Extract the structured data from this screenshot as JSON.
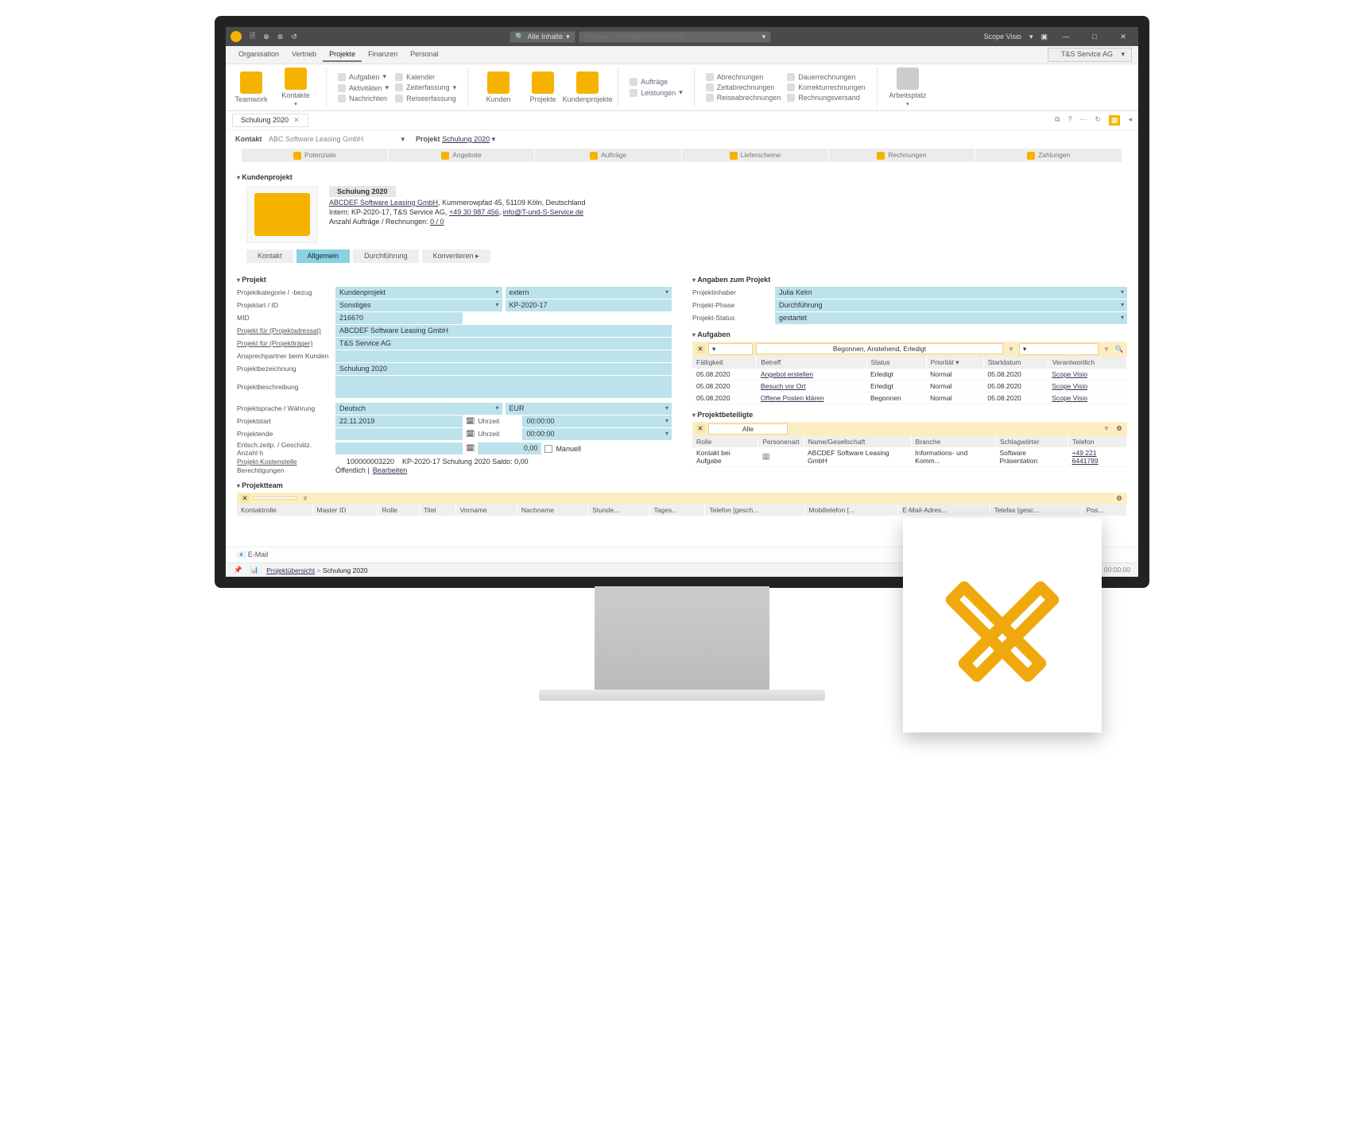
{
  "titlebar": {
    "search_chip": "Alle Inhalte",
    "search_placeholder": "Scopen – Intelligentes Suchfeld",
    "app": "Scope Visio",
    "win": {
      "min": "—",
      "max": "□",
      "close": "✕"
    }
  },
  "menubar": {
    "items": [
      "Organisation",
      "Vertrieb",
      "Projekte",
      "Finanzen",
      "Personal"
    ],
    "active": "Projekte",
    "org": "T&S Service AG"
  },
  "ribbon": {
    "g1": {
      "teamwork": "Teamwork",
      "kontakte": "Kontakte"
    },
    "g2": [
      "Aufgaben",
      "Aktivitäten",
      "Nachrichten"
    ],
    "g3": [
      "Kalender",
      "Zeiterfassung",
      "Reiseerfassung"
    ],
    "g4": {
      "kunden": "Kunden",
      "projekte": "Projekte",
      "kundenproj": "Kundenprojekte"
    },
    "g5": [
      "Aufträge",
      "Leistungen"
    ],
    "g6": [
      "Abrechnungen",
      "Zeitabrechnungen",
      "Reiseabrechnungen"
    ],
    "g7": [
      "Dauerrechnungen",
      "Korrekturrechnungen",
      "Rechnungsversand"
    ],
    "g8": {
      "arbeitsplatz": "Arbeitsplatz"
    }
  },
  "doc_tab": "Schulung 2020",
  "context": {
    "kontakt_lbl": "Kontakt",
    "kontakt_val": "ABC Software Leasing GmbH",
    "projekt_lbl": "Projekt",
    "projekt_val": "Schulung 2020"
  },
  "phases": [
    "Potenziale",
    "Angebote",
    "Aufträge",
    "Lieferscheine",
    "Rechnungen",
    "Zahlungen"
  ],
  "kunden_section": "Kundenprojekt",
  "proj_header": {
    "title": "Schulung 2020",
    "company": "ABCDEF Software Leasing GmbH",
    "address": "Kummerowpfad 45, 51109 Köln, Deutschland",
    "intern_lbl": "Intern:",
    "intern": "KP-2020-17, T&S Service AG,",
    "tel": "+49 30 987 456",
    "mail": "info@T-und-S-Service.de",
    "counts_lbl": "Anzahl Aufträge / Rechnungen:",
    "counts": "0 / 0"
  },
  "inner_tabs": [
    "Kontakt",
    "Allgemein",
    "Durchführung",
    "Konvertieren ▸"
  ],
  "inner_active": "Allgemein",
  "left": {
    "section": "Projekt",
    "rows": {
      "kategorie_lbl": "Projektkategorie / -bezug",
      "kategorie_v1": "Kundenprojekt",
      "kategorie_v2": "extern",
      "art_lbl": "Projektart / ID",
      "art_v1": "Sonstiges",
      "art_v2": "KP-2020-17",
      "mid_lbl": "MID",
      "mid_v": "216670",
      "adressat_lbl": "Projekt für (Projektadressat)",
      "adressat_v": "ABCDEF Software Leasing GmbH",
      "traeger_lbl": "Projekt für (Projektträger)",
      "traeger_v": "T&S Service AG",
      "ansprech_lbl": "Ansprechpartner beim Kunden",
      "ansprech_v": "",
      "bez_lbl": "Projektbezeichnung",
      "bez_v": "Schulung 2020",
      "beschr_lbl": "Projektbeschreibung",
      "beschr_v": "",
      "sprache_lbl": "Projektsprache / Währung",
      "sprache_v1": "Deutsch",
      "sprache_v2": "EUR",
      "start_lbl": "Projektstart",
      "start_v": "22.11.2019",
      "uhrzeit_lbl": "Uhrzeit",
      "start_time": "00:00:00",
      "ende_lbl": "Projektende",
      "ende_v": "",
      "ende_time": "00:00:00",
      "entsch_lbl": "Entsch.zeitp. / Geschätz. Anzahl h",
      "entsch_num": "0,00",
      "manuell": "Manuell",
      "kosten_lbl": "Projekt-Kostenstelle",
      "kosten_num": "100000003220",
      "kosten_txt": "KP-2020-17 Schulung 2020 Saldo: 0,00",
      "berecht_lbl": "Berechtigungen",
      "berecht_v": "Öffentlich | ",
      "berecht_edit": "Bearbeiten"
    }
  },
  "right": {
    "section": "Angaben zum Projekt",
    "inhaber_lbl": "Projektinhaber",
    "inhaber_v": "Julia Kelm",
    "phase_lbl": "Projekt-Phase",
    "phase_v": "Durchführung",
    "status_lbl": "Projekt-Status",
    "status_v": "gestartet",
    "aufgaben_section": "Aufgaben",
    "aufgaben_filter": "Begonnen, Anstehend, Erledigt",
    "aufgaben_cols": [
      "Fälligkeit",
      "Betreff",
      "Status",
      "Priorität",
      "Startdatum",
      "Verantwortlich"
    ],
    "aufgaben_rows": [
      {
        "due": "05.08.2020",
        "subj": "Angebot erstellen",
        "status": "Erledigt",
        "prio": "Normal",
        "start": "05.08.2020",
        "resp": "Scope Visio"
      },
      {
        "due": "05.08.2020",
        "subj": "Besuch vor Ort",
        "status": "Erledigt",
        "prio": "Normal",
        "start": "05.08.2020",
        "resp": "Scope Visio"
      },
      {
        "due": "05.08.2020",
        "subj": "Offene Posten klären",
        "status": "Begonnen",
        "prio": "Normal",
        "start": "05.08.2020",
        "resp": "Scope Visio"
      }
    ],
    "beteiligte_section": "Projektbeteiligte",
    "beteiligte_filter": "Alle",
    "beteiligte_cols": [
      "Rolle",
      "Personenart",
      "Name/Gesellschaft",
      "Branche",
      "Schlagwörter",
      "Telefon"
    ],
    "beteiligte_rows": [
      {
        "rolle": "Kontakt bei Aufgabe",
        "art": "",
        "name": "ABCDEF Software Leasing GmbH",
        "branche": "Informations- und Komm...",
        "tags": "Software Präsentation",
        "tel": "+49 221 6441789"
      }
    ]
  },
  "team": {
    "section": "Projektteam",
    "cols": [
      "Kontaktrolle",
      "Master ID",
      "Rolle",
      "Titel",
      "Vorname",
      "Nachname",
      "Stunde...",
      "Tages...",
      "Telefon [gesch...",
      "Mobiltelefon [...",
      "E-Mail-Adres...",
      "Telefax [gesc...",
      "Pos..."
    ]
  },
  "email_lbl": "E-Mail",
  "footer": {
    "crumb1": "Projektübersicht",
    "crumb2": "Schulung 2020",
    "time": "00:00:00"
  }
}
